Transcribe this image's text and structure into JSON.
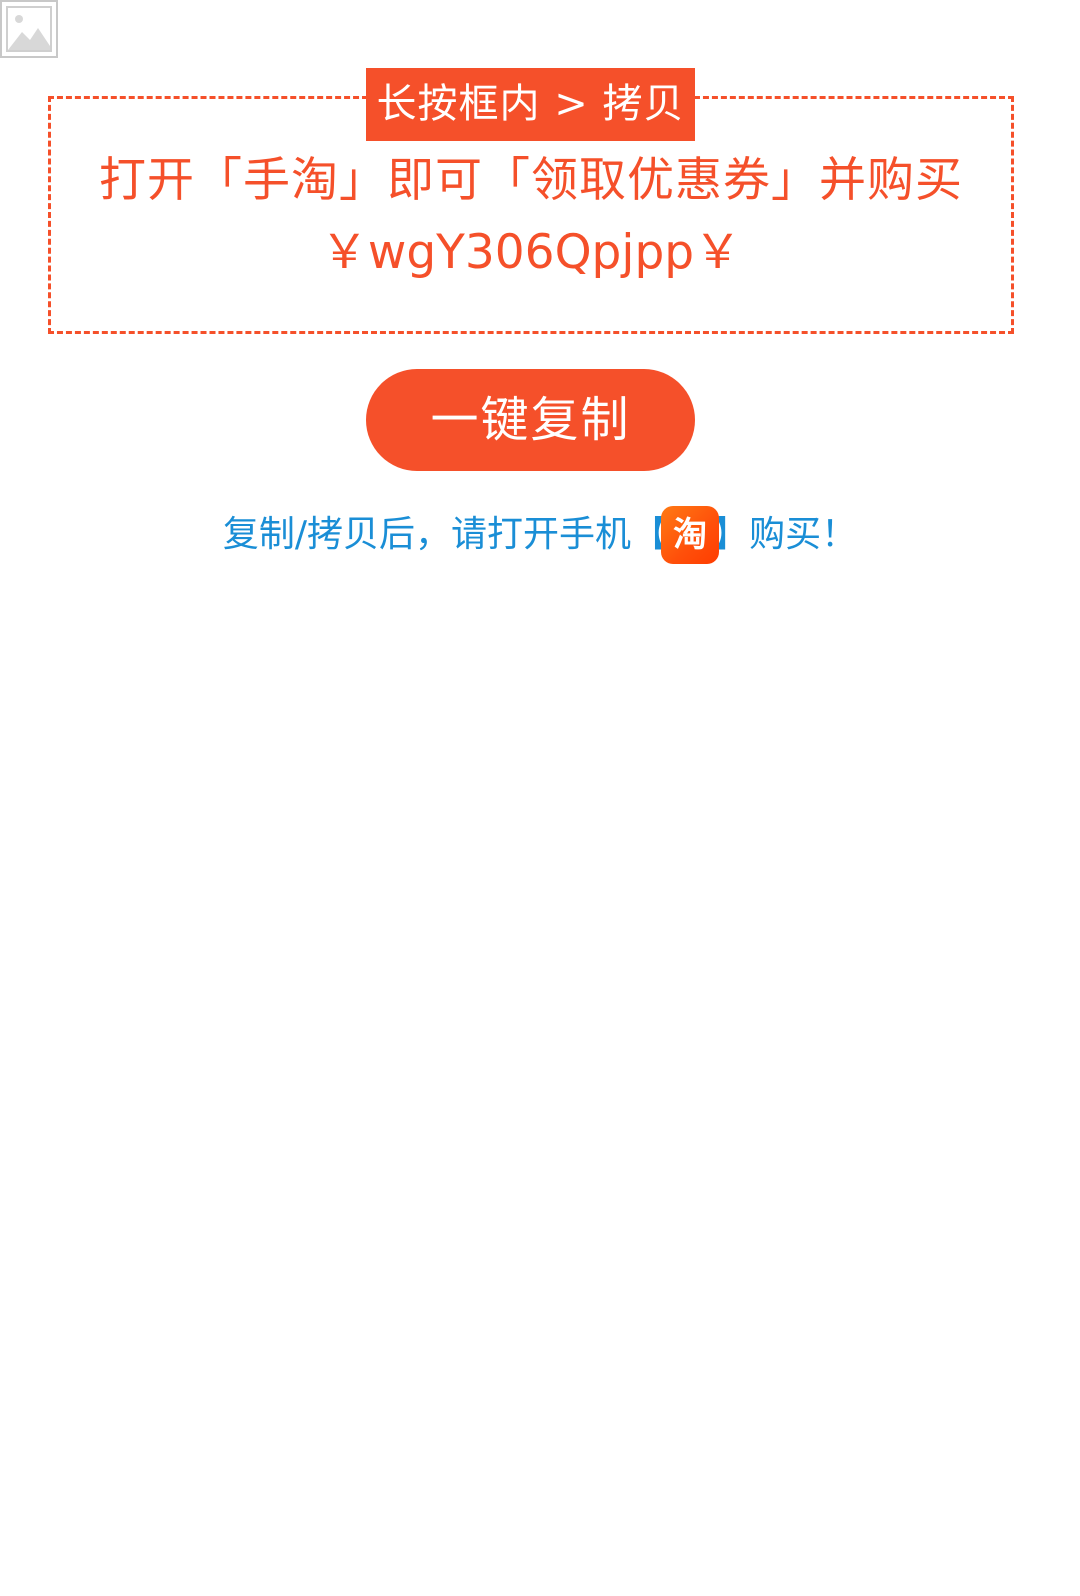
{
  "box_label": "长按框内 > 拷贝",
  "promo": {
    "line1": "打开「手淘」即可「领取优惠券」并购买",
    "line2": "￥wgY306Qpjpp￥"
  },
  "copy_button_label": "一键复制",
  "hint": {
    "before": "复制/拷贝后，请打开手机【",
    "icon_char": "淘",
    "after": "】购买！"
  },
  "icons": {
    "broken_image": "broken-image-icon",
    "app": "taobao-app-icon"
  },
  "colors": {
    "accent": "#f5502a",
    "hint_text": "#1a8ed6",
    "background": "#ffffff"
  }
}
